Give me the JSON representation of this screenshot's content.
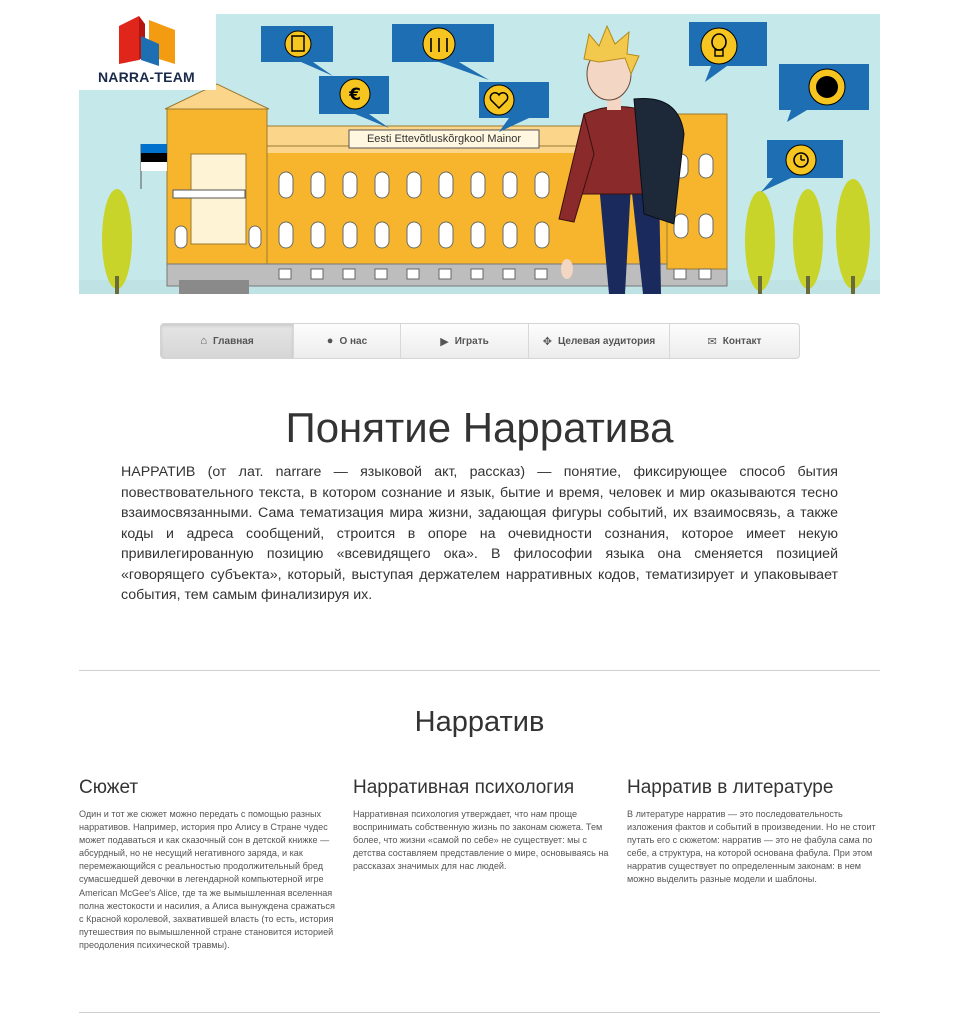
{
  "logo": {
    "text": "NARRA-TEAM"
  },
  "banner": {
    "building_sign": "Eesti Ettevõtluskõrgkool Mainor",
    "bubbles": [
      "clipboard-icon",
      "people-icon",
      "euro-icon",
      "heart-icon",
      "lightbulb-icon",
      "globe-icon",
      "clock-icon"
    ]
  },
  "nav": {
    "items": [
      {
        "label": "Главная",
        "icon": "home-icon"
      },
      {
        "label": "О нас",
        "icon": "user-icon"
      },
      {
        "label": "Играть",
        "icon": "play-icon"
      },
      {
        "label": "Целевая аудитория",
        "icon": "target-icon"
      },
      {
        "label": "Контакт",
        "icon": "envelope-icon"
      }
    ],
    "active": "Главная"
  },
  "intro": {
    "title": "Понятие Нарратива",
    "text": "НАРРАТИВ (от лат. narrare — языковой акт, рассказ) — понятие, фиксирующее способ бытия повествовательного текста, в котором сознание и язык, бытие и время, человек и мир оказываются тесно взаимосвязанными. Сама тематизация мира жизни, задающая фигуры событий, их взаимосвязь, а также коды и адреса сообщений, строится в опоре на очевидности сознания, которое имеет некую привилегированную позицию «всевидящего ока». В философии языка она сменяется позицией «говорящего субъекта», который, выступая держателем нарративных кодов, тематизирует и упаковывает события, тем самым финализируя их."
  },
  "section": {
    "title": "Нарратив",
    "columns": [
      {
        "heading": "Сюжет",
        "text": "Один и тот же сюжет можно передать с помощью разных нарративов. Например, история про Алису в Стране чудес может подаваться и как сказочный сон в детской книжке — абсурдный, но не несущий негативного заряда, и как перемежающийся с реальностью продолжительный бред сумасшедшей девочки в легендарной компьютерной игре American McGee's Alice, где та же вымышленная вселенная полна жестокости и насилия, а Алиса вынуждена сражаться с Красной королевой, захватившей власть (то есть, история путешествия по вымышленной стране становится историей преодоления психической травмы)."
      },
      {
        "heading": "Нарративная психология",
        "text": "Нарративная психология утверждает, что нам проще воспринимать собственную жизнь по законам сюжета. Тем более, что жизни «самой по себе» не существует: мы с детства составляем представление о мире, основываясь на рассказах значимых для нас людей."
      },
      {
        "heading": "Нарратив в литературе",
        "text": "В литературе нарратив — это последовательность изложения фактов и событий в произведении. Но не стоит путать его с сюжетом: нарратив — это не фабула сама по себе, а структура, на которой основана фабула. При этом нарратив существует по определенным законам: в нем можно выделить разные модели и шаблоны."
      }
    ]
  },
  "colors": {
    "banner_bg": "#c5e9ea",
    "building_yellow": "#f7b52e",
    "bubble_blue": "#1e6eb4",
    "logo_red": "#e0251b",
    "logo_orange": "#f39c12",
    "jacket": "#8b2a2a"
  }
}
